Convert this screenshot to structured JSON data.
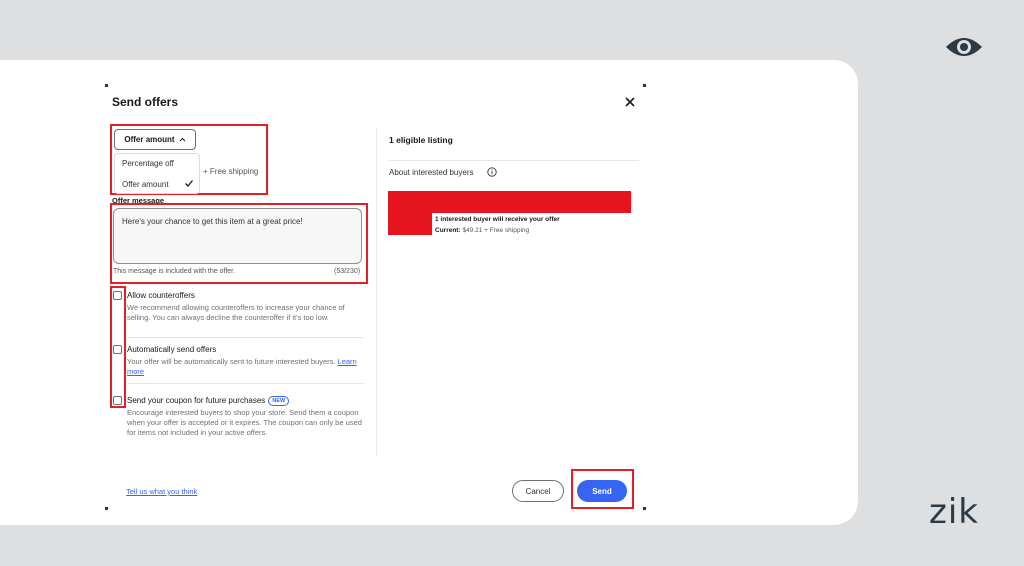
{
  "dialog": {
    "title": "Send offers"
  },
  "offer_type": {
    "button_label": "Offer amount",
    "options": [
      "Percentage off",
      "Offer amount"
    ],
    "selected": "Offer amount",
    "shipping_note": "+ Free shipping"
  },
  "message": {
    "label": "Offer message",
    "value": "Here's your chance to get this item at a great price!",
    "hint": "This message is included with the offer.",
    "counter": "(53/230)"
  },
  "options": [
    {
      "title": "Allow counteroffers",
      "description": "We recommend allowing counteroffers to increase your chance of selling. You can always decline the counteroffer if it's too low.",
      "checked": false
    },
    {
      "title": "Automatically send offers",
      "description": "Your offer will be automatically sent to future interested buyers.",
      "link": "Learn more",
      "checked": false
    },
    {
      "title": "Send your coupon for future purchases",
      "badge": "NEW",
      "description": "Encourage interested buyers to shop your store. Send them a coupon when your offer is accepted or it expires. The coupon can only be used for items not included in your active offers.",
      "checked": false
    }
  ],
  "listing": {
    "count_label": "1 eligible listing",
    "about_label": "About interested buyers",
    "buyer_text": "1 interested buyer will receive your offer",
    "current_label": "Current:",
    "current_value": "$49.21 + Free shipping"
  },
  "footer": {
    "feedback_link": "Tell us what you think",
    "cancel_label": "Cancel",
    "send_label": "Send"
  },
  "brand": {
    "logo_text": "zik"
  },
  "colors": {
    "accent": "#3665f3",
    "highlight": "#e3202a",
    "background": "#dddfe0"
  }
}
